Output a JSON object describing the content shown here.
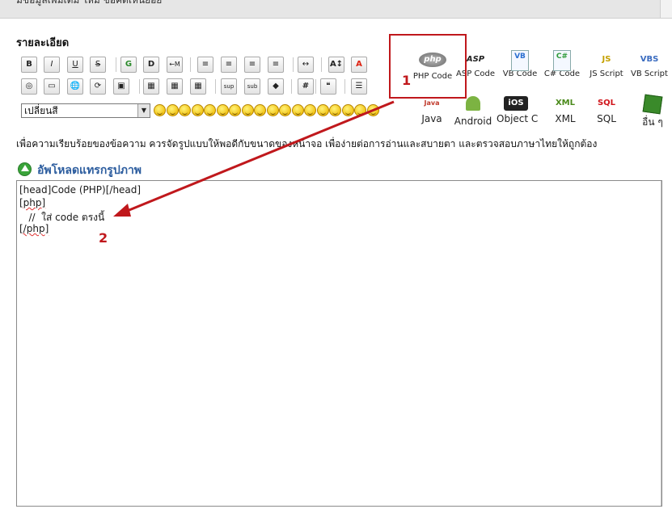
{
  "topbar": {
    "cut_text": "มีข้อมูลเพิ่มเติม ใหม่ ข้อคิดเห็นย่อย"
  },
  "heading": "รายละเอียด",
  "toolbar": {
    "row1": [
      {
        "name": "bold-button",
        "text": "B",
        "style": "bold"
      },
      {
        "name": "italic-button",
        "text": "I",
        "style": "italic"
      },
      {
        "name": "underline-button",
        "text": "U",
        "style": "underline"
      },
      {
        "name": "strike-button",
        "text": "S",
        "style": "strike"
      },
      {
        "name": "google-button",
        "text": "G",
        "style": "green"
      },
      {
        "name": "dailymotion-button",
        "text": "D",
        "style": "bold"
      },
      {
        "name": "move-left-button",
        "text": "←M",
        "style": "small"
      },
      {
        "name": "align-left-button",
        "text": "≡",
        "style": ""
      },
      {
        "name": "align-justify-button",
        "text": "≡",
        "style": ""
      },
      {
        "name": "align-center-button",
        "text": "≡",
        "style": ""
      },
      {
        "name": "align-right-button",
        "text": "≡",
        "style": ""
      },
      {
        "name": "hr-button",
        "text": "↔",
        "style": ""
      },
      {
        "name": "font-size-button",
        "text": "A↕",
        "style": "bold"
      },
      {
        "name": "font-color-button",
        "text": "A",
        "style": "red"
      }
    ],
    "row2": [
      {
        "name": "image-link-button",
        "text": "◎",
        "style": ""
      },
      {
        "name": "image-button",
        "text": "▭",
        "style": ""
      },
      {
        "name": "web-link-button",
        "text": "🌐",
        "style": ""
      },
      {
        "name": "refresh-button",
        "text": "⟳",
        "style": ""
      },
      {
        "name": "upload-image-button",
        "text": "▣",
        "style": ""
      },
      {
        "name": "table-button",
        "text": "▦",
        "style": ""
      },
      {
        "name": "table-blue-button",
        "text": "▦",
        "style": ""
      },
      {
        "name": "table-grid-button",
        "text": "▦",
        "style": ""
      },
      {
        "name": "superscript-button",
        "text": "sup",
        "style": "tiny"
      },
      {
        "name": "subscript-button",
        "text": "sub",
        "style": "tiny"
      },
      {
        "name": "eraser-button",
        "text": "◆",
        "style": ""
      },
      {
        "name": "hash-button",
        "text": "#",
        "style": "bold"
      },
      {
        "name": "quote-button",
        "text": "❝",
        "style": ""
      },
      {
        "name": "list-button",
        "text": "☰",
        "style": ""
      }
    ],
    "select_value": "เปลี่ยนสี"
  },
  "languages": [
    {
      "name": "php-code",
      "label": "PHP Code",
      "icon": "php",
      "color": "#555"
    },
    {
      "name": "asp-code",
      "label": "ASP Code",
      "icon": "ASP",
      "color": "#222"
    },
    {
      "name": "vb-code",
      "label": "VB Code",
      "icon": "VB",
      "color": "#2a6fd0"
    },
    {
      "name": "csharp-code",
      "label": "C# Code",
      "icon": "C#",
      "color": "#2e9b3a"
    },
    {
      "name": "js-script",
      "label": "JS Script",
      "icon": "JS",
      "color": "#c4a000"
    },
    {
      "name": "vb-script",
      "label": "VB Script",
      "icon": "VBS",
      "color": "#3a6bbf"
    },
    {
      "name": "java",
      "label": "Java",
      "icon": "Java",
      "color": "#c0392b"
    },
    {
      "name": "android",
      "label": "Android",
      "icon": "Android",
      "color": "#7cb342"
    },
    {
      "name": "object-c",
      "label": "Object C",
      "icon": "iOS",
      "color": "#222"
    },
    {
      "name": "xml",
      "label": "XML",
      "icon": "XML",
      "color": "#4a8a1a"
    },
    {
      "name": "sql",
      "label": "SQL",
      "icon": "SQL",
      "color": "#d0141a"
    },
    {
      "name": "others",
      "label": "อื่น ๆ",
      "icon": "puzzle",
      "color": "#3a8a2a"
    }
  ],
  "info_text": "เพื่อความเรียบร้อยของข้อความ ควรจัดรูปแบบให้พอดีกับขนาดของหน้าจอ เพื่อง่ายต่อการอ่านและสบายตา และตรวจสอบภาษาไทยให้ถูกต้อง",
  "upload_label": "อัพโหลดแทรกรูปภาพ",
  "editor_lines": [
    "[head]Code (PHP)[/head]",
    "[php]",
    "   //  ใส่ code ตรงนี้",
    "[/php]"
  ],
  "annotations": {
    "one": "1",
    "two": "2"
  },
  "colors": {
    "annotation": "#c0181c",
    "link": "#2b5c9e"
  }
}
